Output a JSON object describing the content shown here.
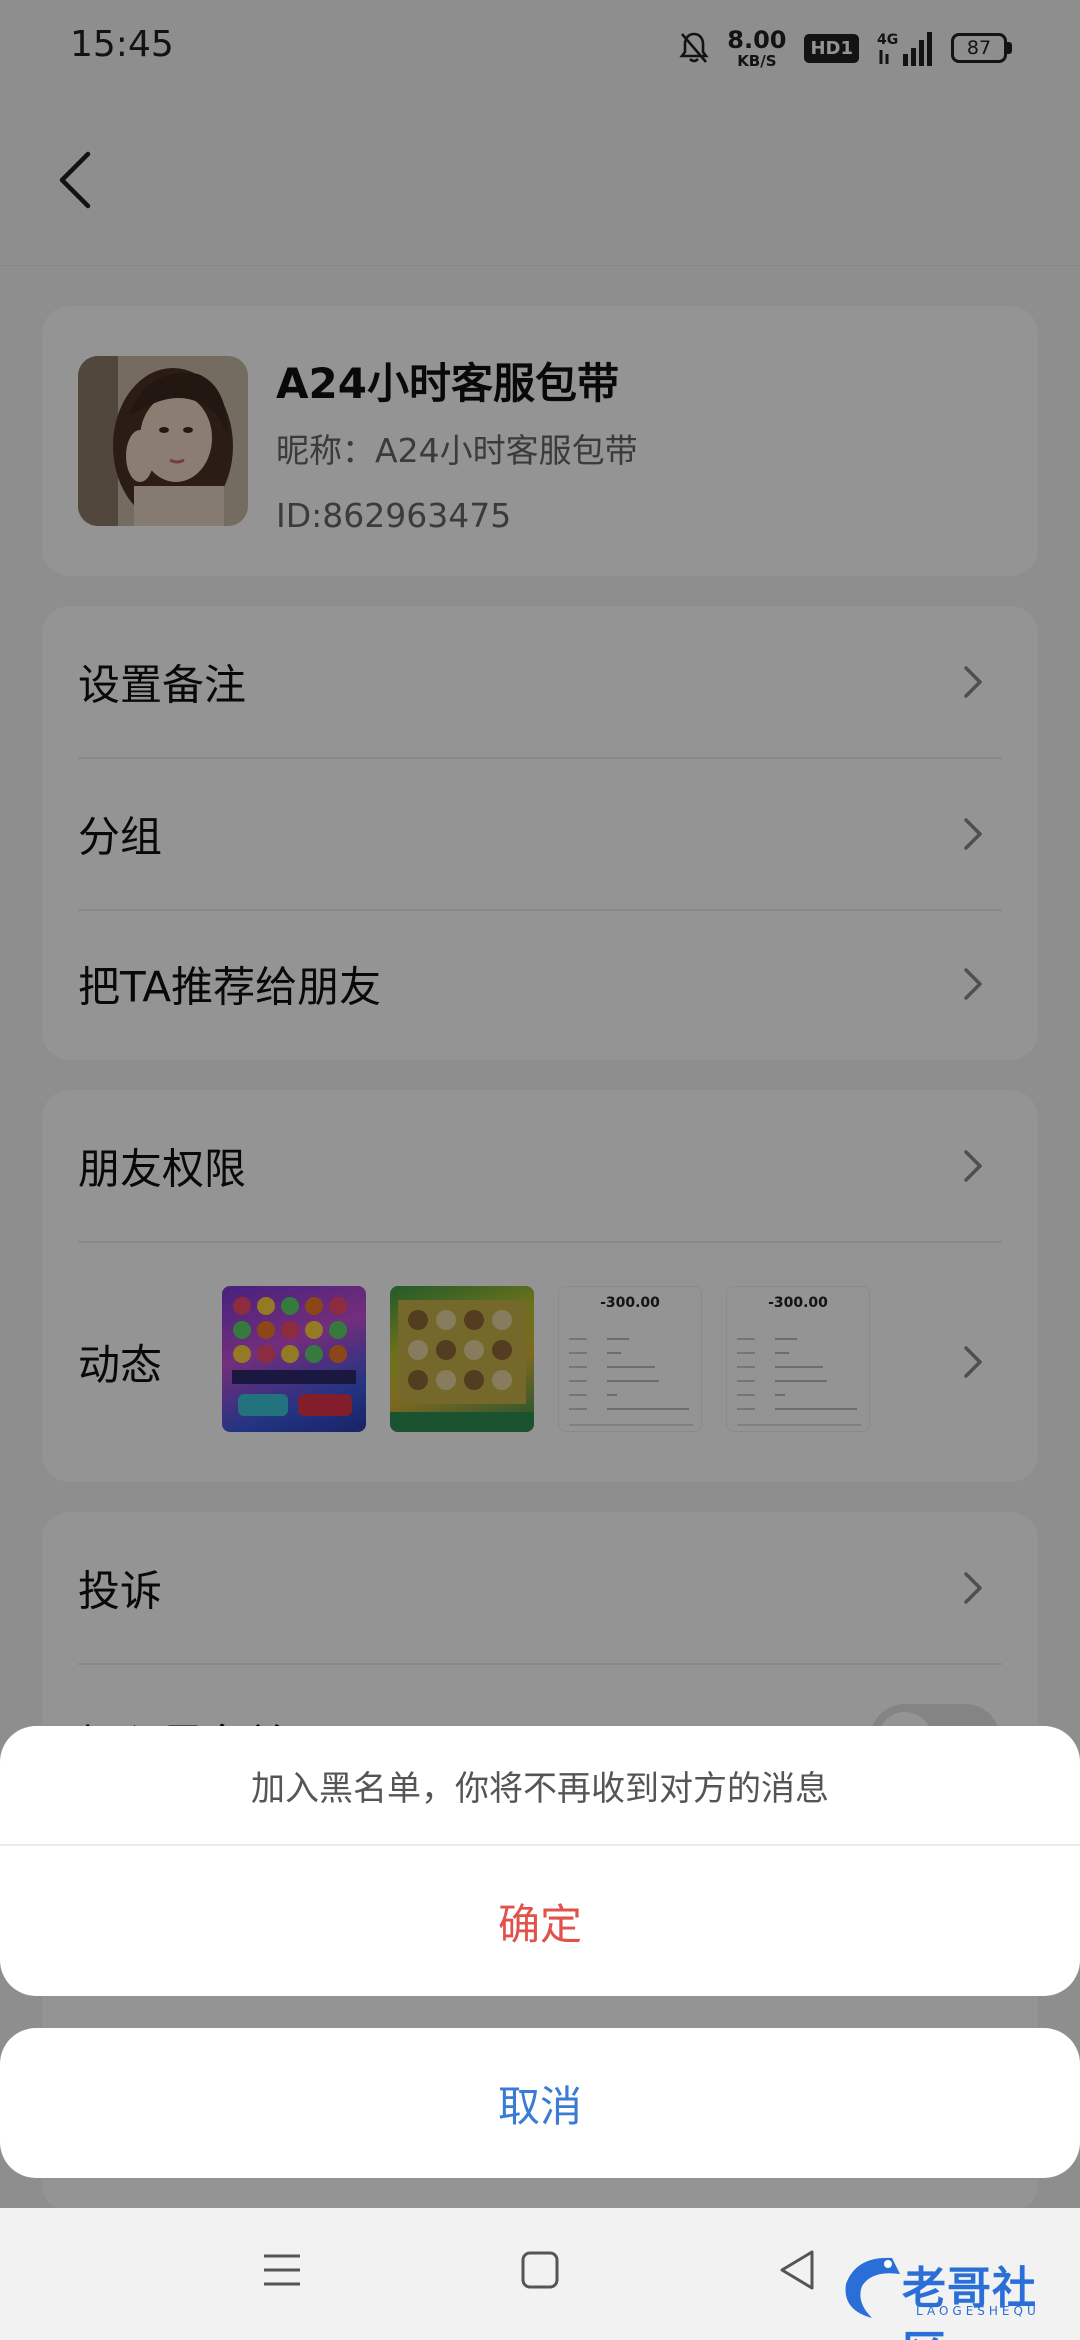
{
  "status_bar": {
    "time": "15:45",
    "net_speed": "8.00",
    "net_unit": "KB/S",
    "hd_label": "HD1",
    "network": "4G",
    "battery": "87"
  },
  "profile": {
    "name": "A24小时客服包带",
    "nickname": "昵称：A24小时客服包带",
    "id": "ID:862963475"
  },
  "menu_group1": [
    {
      "label": "设置备注"
    },
    {
      "label": "分组"
    },
    {
      "label": "把TA推荐给朋友"
    }
  ],
  "menu_group2": {
    "permissions": "朋友权限",
    "moments": "动态",
    "moment_thumbs": [
      {
        "type": "game",
        "icon": "game-thumbnail"
      },
      {
        "type": "game",
        "icon": "game-thumbnail"
      },
      {
        "type": "receipt",
        "amount": "-300.00"
      },
      {
        "type": "receipt",
        "amount": "-300.00"
      }
    ]
  },
  "menu_group3": {
    "complain": "投诉",
    "blacklist": "加入黑名单"
  },
  "action_sheet": {
    "message": "加入黑名单，你将不再收到对方的消息",
    "confirm": "确定",
    "cancel": "取消"
  },
  "watermark": {
    "text": "老哥社区",
    "sub": "LAOGESHEQU"
  },
  "colors": {
    "confirm": "#e0524b",
    "cancel": "#3a7bd5",
    "overlay": "rgba(0,0,0,0.42)"
  }
}
